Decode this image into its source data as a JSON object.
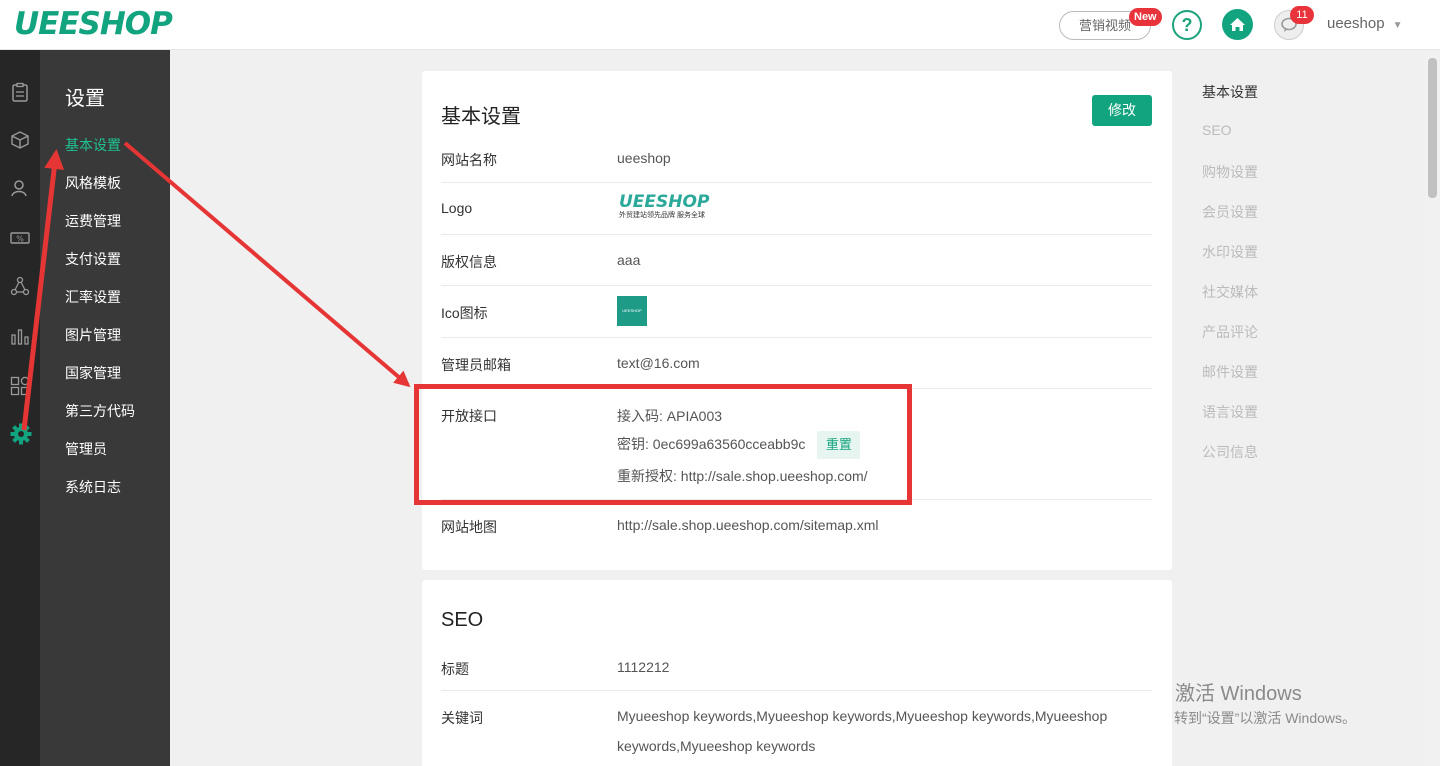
{
  "header": {
    "logo": "UEESHOP",
    "marketing_video": "营销视频",
    "new_badge": "New",
    "help": "?",
    "messages_count": "11",
    "username": "ueeshop"
  },
  "iconbar": {
    "icons": [
      "orders-icon",
      "products-icon",
      "users-icon",
      "promotion-icon",
      "distribution-icon",
      "analytics-icon",
      "apps-icon",
      "settings-gear-icon"
    ]
  },
  "sidenav": {
    "title": "设置",
    "items": [
      "基本设置",
      "风格模板",
      "运费管理",
      "支付设置",
      "汇率设置",
      "图片管理",
      "国家管理",
      "第三方代码",
      "管理员",
      "系统日志"
    ]
  },
  "basic": {
    "title": "基本设置",
    "edit": "修改",
    "site_name_label": "网站名称",
    "site_name": "ueeshop",
    "logo_label": "Logo",
    "logo_text": "UEESHOP",
    "logo_slogan": "外贸建站领先品牌 服务全球",
    "copyright_label": "版权信息",
    "copyright": "aaa",
    "ico_label": "Ico图标",
    "ico_text": "UEESHOP",
    "email_label": "管理员邮箱",
    "email": "text@16.com",
    "api_label": "开放接口",
    "api_code": "接入码: APIA003",
    "api_key": "密钥: 0ec699a63560cceabb9c",
    "reset": "重置",
    "reauth": "重新授权: http://sale.shop.ueeshop.com/",
    "sitemap_label": "网站地图",
    "sitemap": "http://sale.shop.ueeshop.com/sitemap.xml"
  },
  "seo": {
    "title": "SEO",
    "title_label": "标题",
    "title_value": "1112212",
    "keywords_label": "关键词",
    "keywords_line1": "Myueeshop keywords,Myueeshop keywords,Myueeshop keywords,Myueeshop",
    "keywords_line2": "keywords,Myueeshop keywords"
  },
  "anchor_nav": [
    "基本设置",
    "SEO",
    "购物设置",
    "会员设置",
    "水印设置",
    "社交媒体",
    "产品评论",
    "邮件设置",
    "语言设置",
    "公司信息"
  ],
  "watermark": {
    "line1": "激活 Windows",
    "line2": "转到“设置”以激活 Windows。"
  },
  "colors": {
    "brand": "#12a37f",
    "highlight": "#e63535"
  }
}
